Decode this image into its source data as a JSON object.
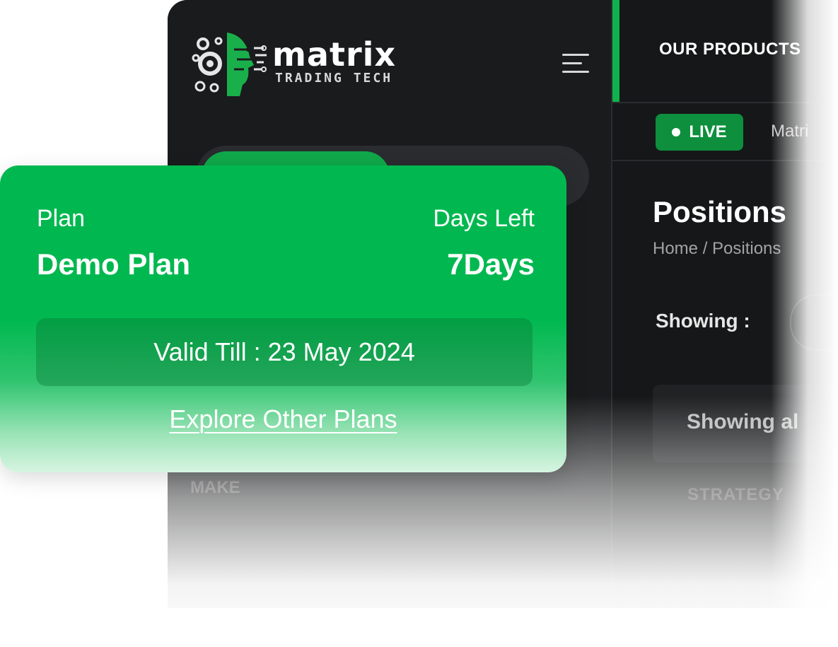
{
  "brand": {
    "name": "matrix",
    "tagline": "TRADING TECH",
    "accent_color": "#0fb24c"
  },
  "header": {
    "nav_item": "OUR PRODUCTS",
    "live_label": "LIVE",
    "secondary_link": "Matri"
  },
  "page": {
    "title": "Positions",
    "breadcrumb": "Home / Positions",
    "showing_label": "Showing :",
    "info_box_text": "Showing al",
    "table_header_partial": "STRATEGY"
  },
  "sidebar": {
    "faint_label": "MAKE"
  },
  "plan_card": {
    "plan_label": "Plan",
    "plan_value": "Demo Plan",
    "days_label": "Days Left",
    "days_value": "7Days",
    "valid_till": "Valid Till : 23 May 2024",
    "explore_link": "Explore Other Plans",
    "color": "#00b84f"
  },
  "icons": {
    "menu": "hamburger-menu-icon",
    "logo": "matrix-gear-face-logo-icon",
    "live_dot": "live-status-dot-icon"
  }
}
